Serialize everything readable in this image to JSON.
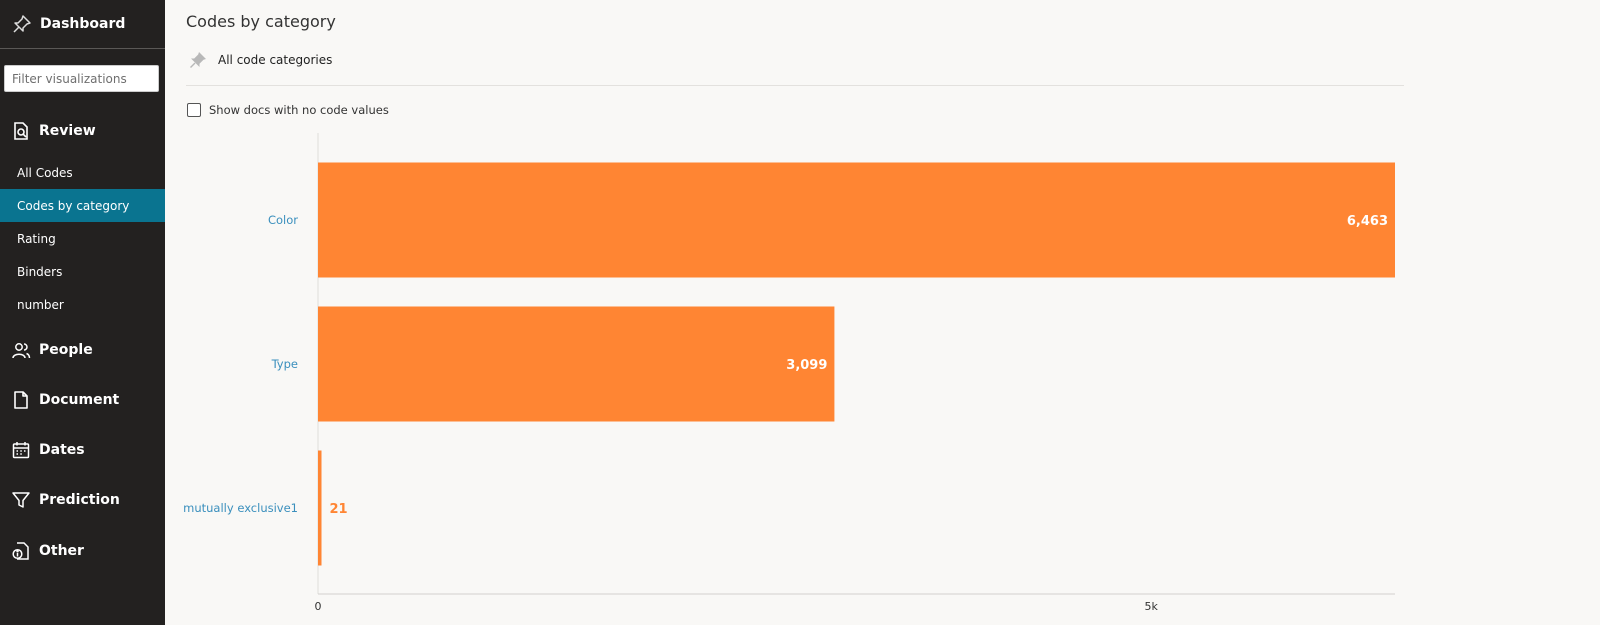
{
  "sidebar": {
    "dashboard_label": "Dashboard",
    "filter_placeholder": "Filter visualizations",
    "sections": {
      "review": "Review",
      "people": "People",
      "document": "Document",
      "dates": "Dates",
      "prediction": "Prediction",
      "other": "Other"
    },
    "review_items": [
      "All Codes",
      "Codes by category",
      "Rating",
      "Binders",
      "number"
    ],
    "active_item": "Codes by category"
  },
  "main": {
    "title": "Codes by category",
    "pinned_label": "All code categories",
    "checkbox_label": "Show docs with no code values",
    "checkbox_checked": false
  },
  "colors": {
    "bar": "#ff8533",
    "active_nav": "#0a7490",
    "category_text": "#3a8fbd"
  },
  "chart_data": {
    "type": "bar",
    "orientation": "horizontal",
    "categories": [
      "Color",
      "Type",
      "mutually exclusive1"
    ],
    "values": [
      6463,
      3099,
      21
    ],
    "value_labels": [
      "6,463",
      "3,099",
      "21"
    ],
    "x_ticks": [
      0,
      5000
    ],
    "x_tick_labels": [
      "0",
      "5k"
    ],
    "xlim": [
      0,
      6463
    ],
    "grid": false
  }
}
